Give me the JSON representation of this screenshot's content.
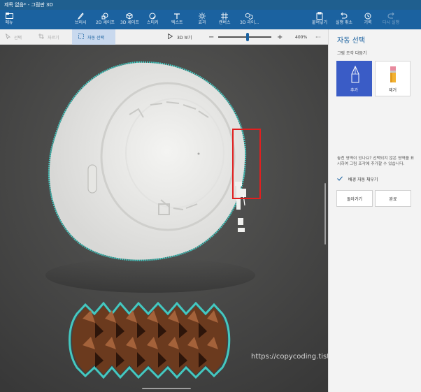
{
  "window": {
    "title": "제목 없음* - 그림판 3D"
  },
  "ribbon": {
    "menu": "메뉴",
    "tools": [
      {
        "label": "브러시",
        "icon": "brush-icon"
      },
      {
        "label": "2D 셰이프",
        "icon": "2d-shapes-icon"
      },
      {
        "label": "3D 셰이프",
        "icon": "3d-shapes-icon"
      },
      {
        "label": "스티커",
        "icon": "sticker-icon"
      },
      {
        "label": "텍스트",
        "icon": "text-icon"
      },
      {
        "label": "효과",
        "icon": "effects-icon"
      },
      {
        "label": "캔버스",
        "icon": "canvas-icon"
      },
      {
        "label": "3D 라이...",
        "icon": "3d-library-icon"
      }
    ],
    "right_tools": [
      {
        "label": "붙여넣기",
        "icon": "paste-icon"
      },
      {
        "label": "실행 취소",
        "icon": "undo-icon"
      },
      {
        "label": "기록",
        "icon": "history-icon"
      },
      {
        "label": "다시 실행",
        "icon": "redo-icon"
      }
    ]
  },
  "toolbar": {
    "select": "선택",
    "crop": "자르기",
    "magic_select": "자동 선택",
    "view_3d": "3D 보기",
    "zoom_out": "−",
    "zoom_in": "+",
    "zoom_level": "400%",
    "more": "···",
    "zoom_value_pct": 55
  },
  "panel": {
    "title": "자동 선택",
    "subtitle": "그림 조각 다듬기",
    "add_label": "추가",
    "remove_label": "제거",
    "description": "놓친 영역이 있나요? 선택되지 않은 영역을 표시하여 그림 조각에 추가할 수 있습니다.",
    "autofill_label": "배경 자동 채우기",
    "autofill_checked": true,
    "back_button": "돌아가기",
    "done_button": "완료"
  },
  "watermark": "https://copycoding.tistory.com/",
  "colors": {
    "accent": "#1b62a0",
    "selection": "#3a5cc6",
    "outline": "#44c8c0",
    "highlight_box": "#e11f1f"
  }
}
